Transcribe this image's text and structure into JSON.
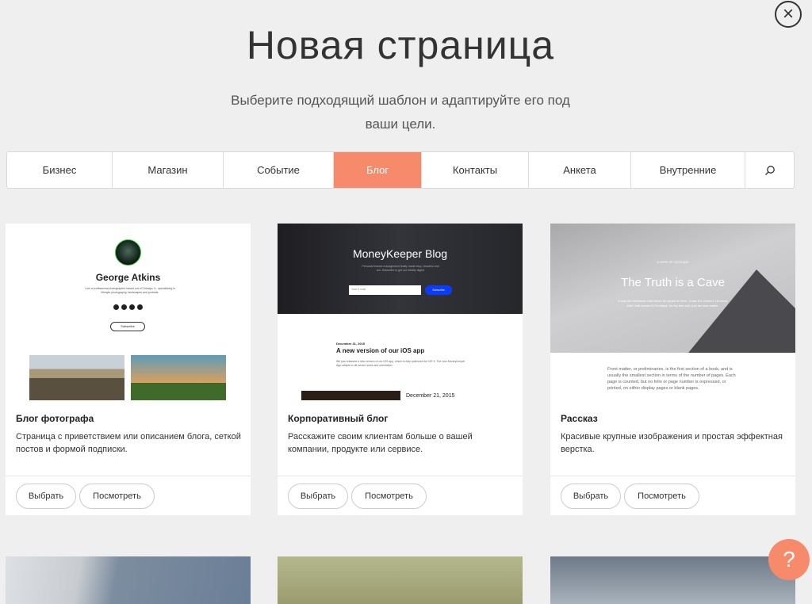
{
  "title": "Новая страница",
  "subtitle": "Выберите подходящий шаблон и адаптируйте его под ваши цели.",
  "tabs": [
    "Бизнес",
    "Магазин",
    "Событие",
    "Блог",
    "Контакты",
    "Анкета",
    "Внутренние"
  ],
  "active_tab": "Блог",
  "accent": "#f88a6c",
  "cards": [
    {
      "title": "Блог фотографа",
      "desc": "Страница с приветствием или описанием блога, сеткой постов и формой подписки.",
      "select": "Выбрать",
      "view": "Посмотреть",
      "preview": {
        "name": "George Atkins",
        "bio": "I am a professional photographer based out of Chicago, IL, specializing in lifestyle photography, landscapes and portraits.",
        "button": "Subscribe"
      }
    },
    {
      "title": "Корпоративный блог",
      "desc": "Расскажите своим клиентам больше о вашей компании, продукте или сервисе.",
      "select": "Выбрать",
      "view": "Посмотреть",
      "preview": {
        "heading": "MoneyKeeper Blog",
        "tagline": "Personal finance management finally made easy, beautiful and fun. Subscribe to get our weekly digest",
        "email_placeholder": "Your E-mail",
        "button": "Subscribe",
        "date": "December 31, 2015",
        "post_title": "A new version of our iOS app",
        "post_text": "We just released a new version of our iOS app, which is fully optimized for iOS 9. The new MoneyKeeper App adapts to all screen sizes and orientation.",
        "date2": "December 21, 2015"
      }
    },
    {
      "title": "Рассказ",
      "desc": "Красивые крупные изображения и простая эффектная верстка.",
      "select": "Выбрать",
      "view": "Посмотреть",
      "preview": {
        "kicker": "A TASTE OF SCOTLAND",
        "heading": "The Truth is a Cave",
        "lead": "It was the readiness with which he spoke of them. It was the context. He knew that I had arrived in Scotland, for my first visit, just an hour earlier.",
        "body": "Front matter, or preliminaries, is the first section of a book, and is usually the smallest section in terms of the number of pages. Each page is counted, but no folio or page number is expressed, or printed, on either display pages or blank pages."
      }
    }
  ]
}
